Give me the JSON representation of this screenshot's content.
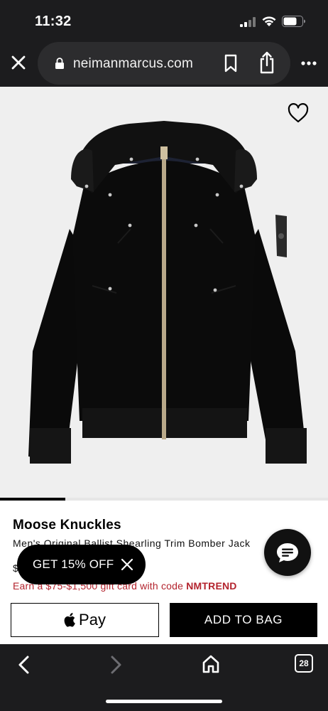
{
  "status_bar": {
    "time": "11:32",
    "icons": [
      "signal-icon",
      "wifi-icon",
      "battery-icon"
    ]
  },
  "browser": {
    "url": "neimanmarcus.com",
    "icons": [
      "close-icon",
      "lock-icon",
      "bookmark-icon",
      "share-icon",
      "more-icon"
    ]
  },
  "product": {
    "brand": "Moose Knuckles",
    "name": "Men's Original Ballist Shearling Trim Bomber Jack",
    "price": "$",
    "promo_prefix": "Earn a $75-$1,500 gift card with code ",
    "promo_code": "NMTREND",
    "carousel_progress": 0.2
  },
  "actions": {
    "apple_pay_label": "Pay",
    "add_to_bag_label": "ADD TO BAG"
  },
  "discount_popup": {
    "label": "GET 15% OFF"
  },
  "toolbar": {
    "tab_count": "28",
    "icons": [
      "back-icon",
      "forward-icon",
      "home-icon",
      "tabs-icon"
    ]
  },
  "colors": {
    "promo": "#b3232d",
    "browser_chrome": "#1c1c1e",
    "url_pill": "#2c2c2e",
    "image_background": "#efefef"
  }
}
